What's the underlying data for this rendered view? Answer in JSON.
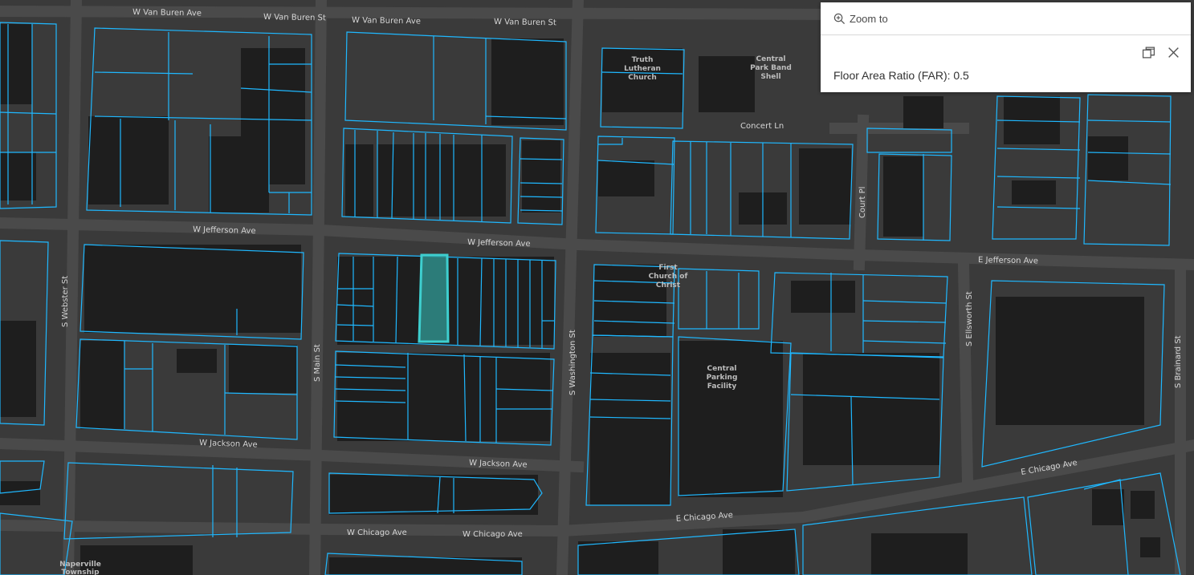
{
  "map": {
    "background": "#3a3a3a",
    "parcel_color": "#1fb8ff",
    "highlight_color": "#3ecfcf",
    "streets": [
      {
        "id": "vanburen1",
        "text": "W Van Buren Ave"
      },
      {
        "id": "vanburen2",
        "text": "W Van Buren St"
      },
      {
        "id": "vanburen3",
        "text": "W Van Buren Ave"
      },
      {
        "id": "vanburen4",
        "text": "W Van Buren St"
      },
      {
        "id": "jefferson1",
        "text": "W Jefferson Ave"
      },
      {
        "id": "jefferson2",
        "text": "W Jefferson Ave"
      },
      {
        "id": "ejefferson",
        "text": "E Jefferson Ave"
      },
      {
        "id": "jackson1",
        "text": "W Jackson Ave"
      },
      {
        "id": "jackson2",
        "text": "W Jackson Ave"
      },
      {
        "id": "chicago1",
        "text": "W Chicago Ave"
      },
      {
        "id": "chicago2",
        "text": "W Chicago Ave"
      },
      {
        "id": "echicago1",
        "text": "E Chicago Ave"
      },
      {
        "id": "echicago2",
        "text": "E Chicago Ave"
      },
      {
        "id": "concert",
        "text": "Concert Ln"
      },
      {
        "id": "webster",
        "text": "S Webster St"
      },
      {
        "id": "main",
        "text": "S Main St"
      },
      {
        "id": "washington",
        "text": "S Washington St"
      },
      {
        "id": "courtpl",
        "text": "Court Pl"
      },
      {
        "id": "ellsworth",
        "text": "S Ellsworth St"
      },
      {
        "id": "brainard",
        "text": "S Brainard St"
      }
    ],
    "pois": [
      {
        "id": "truth",
        "lines": [
          "Truth",
          "Lutheran",
          "Church"
        ]
      },
      {
        "id": "bandshell",
        "lines": [
          "Central",
          "Park Band",
          "Shell"
        ]
      },
      {
        "id": "firstchurch",
        "lines": [
          "First",
          "Church of",
          "Christ"
        ]
      },
      {
        "id": "parking",
        "lines": [
          "Central",
          "Parking",
          "Facility"
        ]
      },
      {
        "id": "township",
        "lines": [
          "Naperville",
          "Township"
        ]
      }
    ]
  },
  "popup": {
    "zoom_label": "Zoom to",
    "content_text": "Floor Area Ratio (FAR): 0.5",
    "icons": {
      "zoom": "zoom-in-icon",
      "dock": "dock-icon",
      "close": "close-icon"
    }
  }
}
